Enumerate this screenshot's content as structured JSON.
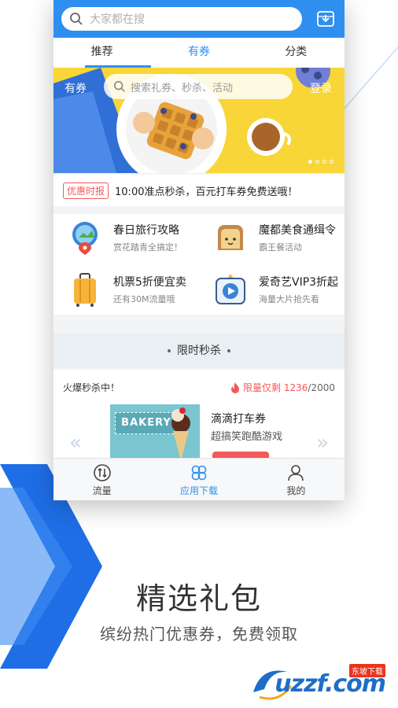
{
  "colors": {
    "primary": "#2f8ff0",
    "banner": "#f8d638",
    "accent_red": "#f25a5a"
  },
  "search": {
    "placeholder": "大家都在搜"
  },
  "tabs": [
    {
      "label": "推荐"
    },
    {
      "label": "有券"
    },
    {
      "label": "分类"
    }
  ],
  "active_tab": "有券",
  "banner": {
    "left_label": "有券",
    "search_placeholder": "搜索礼券、秒杀、活动",
    "login": "登录",
    "slides": 4,
    "current_slide": 1
  },
  "notice": {
    "tag": "优惠时报",
    "message": "10:00准点秒杀，百元打车券免费送哦！"
  },
  "grid": [
    {
      "title": "春日旅行攻略",
      "subtitle": "赏花踏青全搞定！",
      "icon": "map-pin-icon"
    },
    {
      "title": "魔都美食通缉令",
      "subtitle": "霸王餐活动",
      "icon": "toast-icon"
    },
    {
      "title": "机票5折便宜卖",
      "subtitle": "还有30M流量哦",
      "icon": "suitcase-icon"
    },
    {
      "title": "爱奇艺VIP3折起",
      "subtitle": "海量大片抢先看",
      "icon": "video-play-icon"
    }
  ],
  "flash": {
    "section_title": "限时秒杀",
    "hot_label": "火爆秒杀中！",
    "limit_label": "限量仅剩",
    "remaining": "1236",
    "total": "/2000",
    "product_title": "滴滴打车券",
    "product_subtitle": "超搞笑跑酷游戏",
    "image_text": "BAKERY"
  },
  "bottom_nav": [
    {
      "label": "流量",
      "icon": "traffic-icon"
    },
    {
      "label": "应用下载",
      "icon": "apps-icon"
    },
    {
      "label": "我的",
      "icon": "user-icon"
    }
  ],
  "active_nav": "应用下载",
  "footer": {
    "headline": "精选礼包",
    "subline": "缤纷热门优惠券，免费领取"
  },
  "watermark": {
    "text": "uzzf.com",
    "tag": "东坡下载"
  }
}
